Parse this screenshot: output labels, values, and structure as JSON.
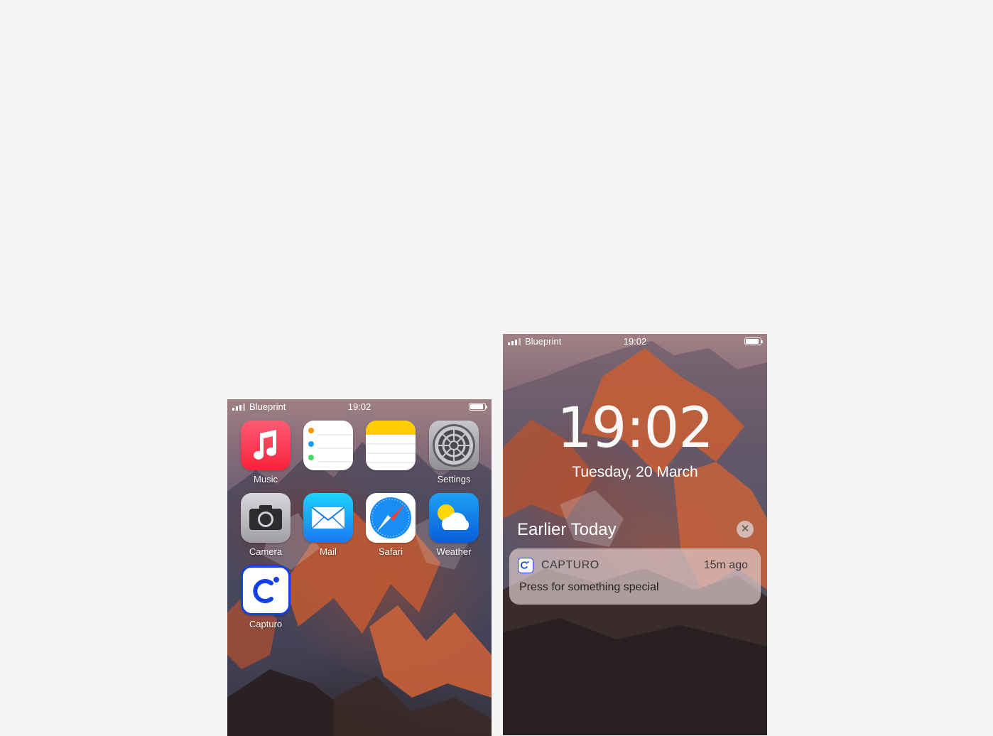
{
  "home_screen": {
    "statusbar": {
      "carrier": "Blueprint",
      "time": "19:02",
      "battery_level": 0.9
    },
    "apps": [
      {
        "label": "Music",
        "icon": "music-icon"
      },
      {
        "label": "",
        "icon": "reminders-icon"
      },
      {
        "label": "",
        "icon": "notes-icon"
      },
      {
        "label": "Settings",
        "icon": "settings-icon"
      },
      {
        "label": "Camera",
        "icon": "camera-icon"
      },
      {
        "label": "Mail",
        "icon": "mail-icon"
      },
      {
        "label": "Safari",
        "icon": "safari-icon"
      },
      {
        "label": "Weather",
        "icon": "weather-icon"
      },
      {
        "label": "Capturo",
        "icon": "capturo-icon"
      }
    ]
  },
  "lock_screen": {
    "statusbar": {
      "carrier": "Blueprint",
      "time": "19:02",
      "battery_level": 0.9
    },
    "time": "19:02",
    "date": "Tuesday, 20 March",
    "section_title": "Earlier Today",
    "close_glyph": "✕",
    "notification": {
      "app_icon_glyph": "C",
      "app_name": "CAPTURO",
      "time_ago": "15m ago",
      "body": "Press for something special"
    }
  },
  "colors": {
    "background": "#f5f5f5",
    "capturo_blue": "#1440e8",
    "music_red": "#fa233b",
    "mail_blue": "#1a78f1"
  }
}
